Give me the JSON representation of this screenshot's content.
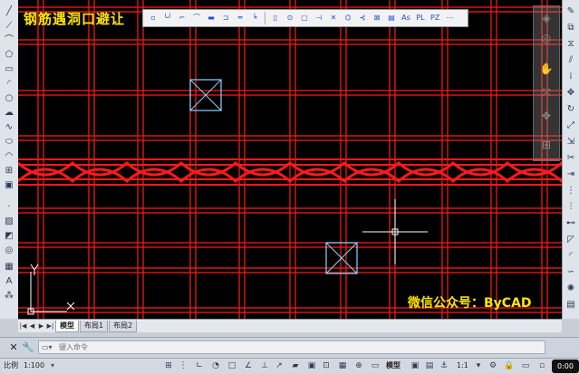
{
  "drawing": {
    "title_overlay": "钢筋遇洞口避让",
    "watermark": "微信公众号：ByCAD"
  },
  "floating_toolbar": {
    "labels": [
      "As",
      "PL",
      "PZ"
    ]
  },
  "layout_tabs": {
    "items": [
      "模型",
      "布局1",
      "布局2"
    ]
  },
  "command_line": {
    "placeholder": "键入命令"
  },
  "status_bar": {
    "scale_label": "比例",
    "scale_value": "1:100",
    "model_label": "模型",
    "annotation_scale": "1:1",
    "timer": "0:00"
  },
  "colors": {
    "grid_red": "#ff1a1a",
    "crosshair": "#ffffff",
    "column_box": "#8fd4ff",
    "overlay_yellow": "#ffe500"
  }
}
